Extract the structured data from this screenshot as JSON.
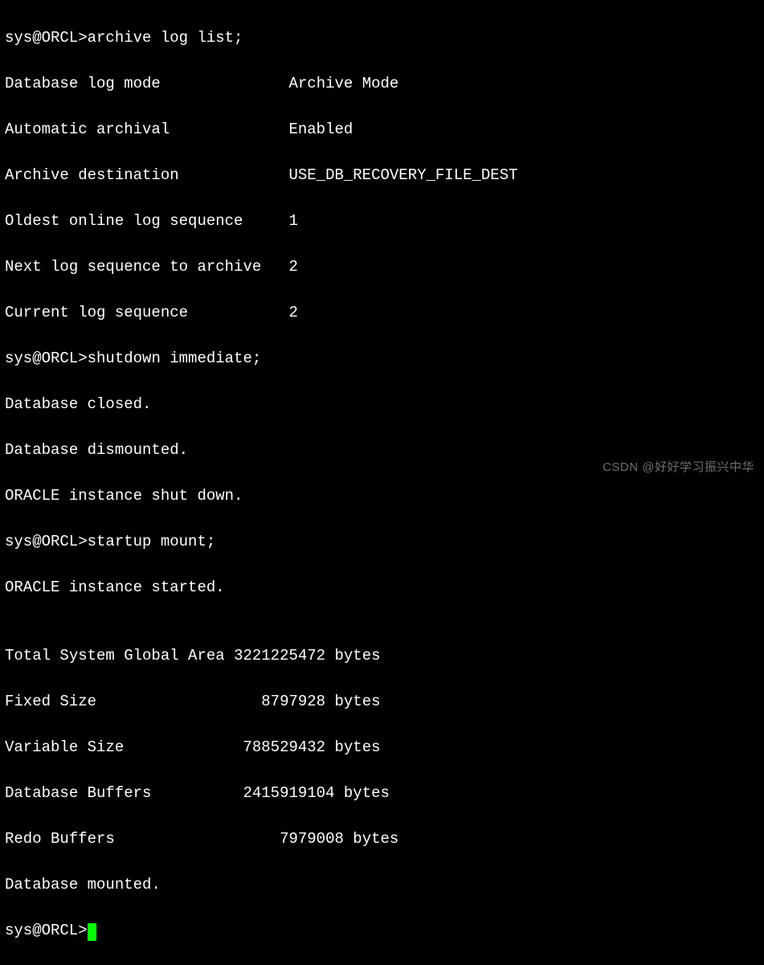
{
  "prompt1": "sys@ORCL>",
  "cmd1": "archive log list;",
  "archive": {
    "rows": [
      {
        "label": "Database log mode",
        "value": "Archive Mode"
      },
      {
        "label": "Automatic archival",
        "value": "Enabled"
      },
      {
        "label": "Archive destination",
        "value": "USE_DB_RECOVERY_FILE_DEST"
      },
      {
        "label": "Oldest online log sequence",
        "value": "1"
      },
      {
        "label": "Next log sequence to archive",
        "value": "2"
      },
      {
        "label": "Current log sequence",
        "value": "2"
      }
    ]
  },
  "prompt2": "sys@ORCL>",
  "cmd2": "shutdown immediate;",
  "shutdown_lines": [
    "Database closed.",
    "Database dismounted.",
    "ORACLE instance shut down."
  ],
  "prompt3": "sys@ORCL>",
  "cmd3": "startup mount;",
  "startup_line": "ORACLE instance started.",
  "blank": "",
  "sga_header": {
    "label": "Total System Global Area",
    "value": "3221225472",
    "unit": "bytes"
  },
  "sga_rows": [
    {
      "label": "Fixed Size",
      "value": "8797928",
      "unit": "bytes"
    },
    {
      "label": "Variable Size",
      "value": "788529432",
      "unit": "bytes"
    },
    {
      "label": "Database Buffers",
      "value": "2415919104",
      "unit": "bytes"
    },
    {
      "label": "Redo Buffers",
      "value": "7979008",
      "unit": "bytes"
    }
  ],
  "mounted_line": "Database mounted.",
  "prompt4": "sys@ORCL>",
  "watermark": "CSDN @好好学习振兴中华"
}
